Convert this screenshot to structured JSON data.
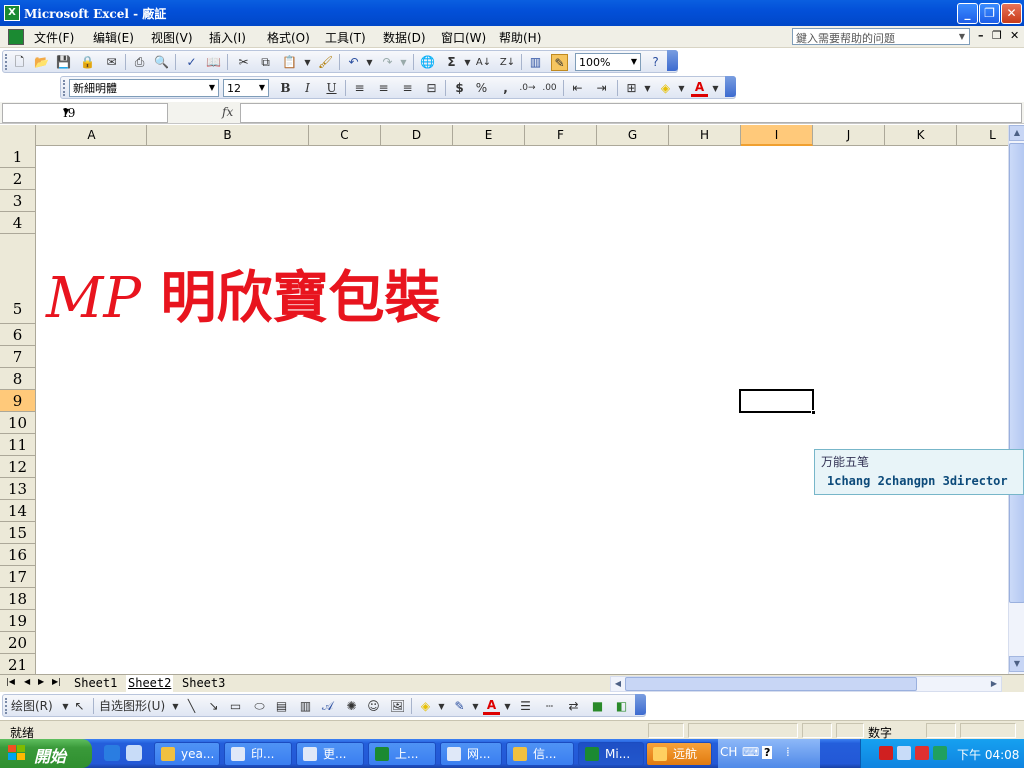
{
  "window": {
    "title": "Microsoft Excel - 廠証",
    "minimize": "_",
    "restore": "❐",
    "close": "✕"
  },
  "menu": {
    "items": [
      "文件(F)",
      "编辑(E)",
      "视图(V)",
      "插入(I)",
      "格式(O)",
      "工具(T)",
      "数据(D)",
      "窗口(W)",
      "帮助(H)"
    ],
    "help_placeholder": "鍵入需要帮助的问题"
  },
  "standard_toolbar": {
    "zoom": "100%"
  },
  "format_toolbar": {
    "font": "新細明體",
    "size": "12",
    "bold": "B",
    "italic": "I",
    "underline": "U",
    "currency": "$",
    "percent": "%",
    "comma": ","
  },
  "formula_bar": {
    "name_box": "I9",
    "fx": "fx",
    "formula": ""
  },
  "sheet": {
    "columns": [
      "A",
      "B",
      "C",
      "D",
      "E",
      "F",
      "G",
      "H",
      "I",
      "J",
      "K",
      "L"
    ],
    "selected_column": "I",
    "rows": [
      "1",
      "2",
      "3",
      "4",
      "5",
      "6",
      "7",
      "8",
      "9",
      "10",
      "11",
      "12",
      "13",
      "14",
      "15",
      "16",
      "17",
      "18",
      "19",
      "20",
      "21"
    ],
    "selected_row": "9",
    "banner_latin": "MP",
    "banner_cjk": " 明欣寶包裝",
    "banner_color": "#e8141e"
  },
  "ime": {
    "title": "万能五笔",
    "candidates": "1chang 2changpn 3director"
  },
  "sheet_tabs": [
    "Sheet1",
    "Sheet2",
    "Sheet3"
  ],
  "active_sheet": "Sheet2",
  "drawing_toolbar": {
    "draw_label": "绘图(R)",
    "autoshapes_label": "自选图形(U)"
  },
  "status": {
    "text": "就绪",
    "num": "数字"
  },
  "taskbar": {
    "start": "開始",
    "tasks": [
      "yea...",
      "印...",
      "更...",
      "上...",
      "网...",
      "信...",
      "Mi...",
      "远航"
    ],
    "active_task": "Mi...",
    "lang": "CH",
    "clock": "下午 04:08"
  }
}
